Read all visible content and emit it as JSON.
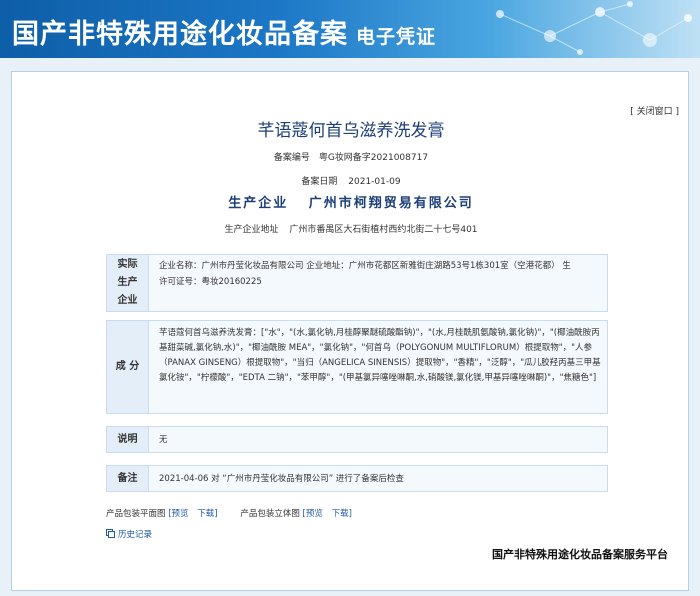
{
  "banner": {
    "title": "国产非特殊用途化妆品备案",
    "subtitle": "电子凭证"
  },
  "close_label": "[ 关闭窗口 ]",
  "product": {
    "name": "芊语蔻何首乌滋养洗发膏",
    "record_no_label": "备案编号",
    "record_no": "粤G妆网备字2021008717",
    "date_label": "备案日期",
    "date": "2021-01-09",
    "company_label": "生产企业",
    "company": "广州市柯翔贸易有限公司",
    "address_label": "生产企业地址",
    "address": "广州市番禺区大石街植村西约北街二十七号401"
  },
  "sections": {
    "producer": {
      "label_lines": [
        "实际",
        "生产",
        "企业"
      ],
      "line1": "企业名称：广州市丹莹化妆品有限公司      企业地址：广州市花都区新雅街庄湖路53号1栋301室（空港花都）      生",
      "line2": "许可证号：粤妆20160225"
    },
    "ingredients": {
      "label": "成 分",
      "text": "芊语蔻何首乌滋养洗发膏：[\"水\"，\"(水,氯化钠,月桂醇聚醚硫酸酯钠)\"，\"(水,月桂酰肌氨酸钠,氯化钠)\"，\"(椰油酰胺丙基甜菜碱,氯化钠,水)\"，\"椰油酰胺 MEA\"，\"氯化钠\"，\"何首乌（POLYGONUM MULTIFLORUM）根提取物\"，\"人参（PANAX GINSENG）根提取物\"，\"当归（ANGELICA SINENSIS）提取物\"，\"香精\"，\"泛醇\"，\"瓜儿胶羟丙基三甲基氯化铵\"，\"柠檬酸\"，\"EDTA 二钠\"，\"苯甲醇\"，\"(甲基氯异噻唑啉酮,水,硝酸镁,氯化镁,甲基异噻唑啉酮)\"，\"焦糖色\"]"
    },
    "notes": {
      "label": "说明",
      "text": "无"
    },
    "remarks": {
      "label": "备注",
      "text": "2021-04-06 对 “广州市丹莹化妆品有限公司” 进行了备案后检查"
    }
  },
  "packaging": {
    "flat_label": "产品包装平面图",
    "solid_label": "产品包装立体图",
    "preview": "预览",
    "download": "下载"
  },
  "history_label": "历史记录",
  "footer": "国产非特殊用途化妆品备案服务平台"
}
